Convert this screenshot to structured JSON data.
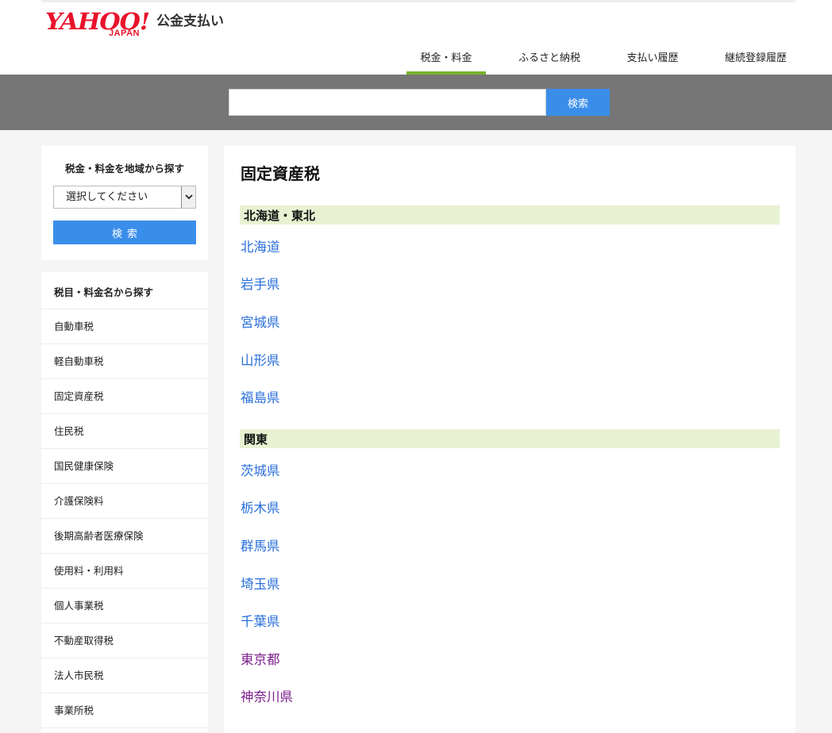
{
  "header": {
    "logo": {
      "yahoo": "YAHOO!",
      "japan": "JAPAN",
      "service": "公金支払い"
    },
    "nav": [
      {
        "label": "税金・料金",
        "active": true
      },
      {
        "label": "ふるさと納税",
        "active": false
      },
      {
        "label": "支払い履歴",
        "active": false
      },
      {
        "label": "継続登録履歴",
        "active": false
      }
    ]
  },
  "search": {
    "value": "",
    "placeholder": "",
    "button_label": "検索"
  },
  "sidebar": {
    "region": {
      "title": "税金・料金を地域から探す",
      "select_value": "選択してください",
      "button_label": "検索"
    },
    "tax_types": {
      "title": "税目・料金名から探す",
      "items": [
        "自動車税",
        "軽自動車税",
        "固定資産税",
        "住民税",
        "国民健康保険",
        "介護保険料",
        "後期高齢者医療保険",
        "使用料・利用料",
        "個人事業税",
        "不動産取得税",
        "法人市民税",
        "事業所税"
      ]
    }
  },
  "main": {
    "title": "固定資産税",
    "sections": [
      {
        "heading": "北海道・東北",
        "prefectures": [
          "北海道",
          "岩手県",
          "宮城県",
          "山形県",
          "福島県"
        ]
      },
      {
        "heading": "関東",
        "prefectures": [
          "茨城県",
          "栃木県",
          "群馬県",
          "埼玉県",
          "千葉県",
          "東京都",
          "神奈川県"
        ]
      }
    ]
  },
  "colors": {
    "accent_blue": "#3a8eea",
    "link": "#2a6fdb",
    "link_visited": "#7b1f8c",
    "active_tab_underline": "#7ab22c",
    "section_head_bg": "#e8f2d2",
    "search_band": "#767676",
    "logo_red": "#e8122a"
  }
}
